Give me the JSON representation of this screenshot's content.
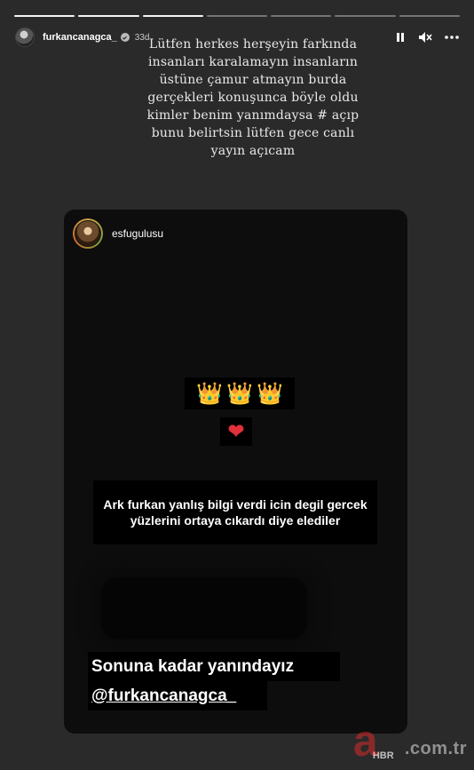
{
  "story": {
    "progress": {
      "total": 7,
      "completed": 3
    },
    "header": {
      "username": "furkancanagca_",
      "time_ago": "33d",
      "icons": [
        "pause-icon",
        "mute-icon",
        "more-icon"
      ]
    },
    "caption": "Lütfen herkes herşeyin farkında insanları karalamayın insanların üstüne çamur atmayın burda gerçekleri konuşunca böyle oldu kimler benim yanımdaysa # açıp bunu belirtsin lütfen gece canlı yayın açıcam",
    "shared_post": {
      "username": "esfugulusu",
      "crowns": [
        "👑",
        "👑",
        "👑"
      ],
      "heart": "❤",
      "message1": "Ark furkan yanlış bilgi verdi icin degil gercek yüzlerini ortaya cıkardı diye elediler",
      "message2": "Sonuna kadar yanındayız",
      "mention": "@furkancanagca_"
    },
    "watermark": {
      "logo": "a",
      "brand": "HBR",
      "domain": ".com.tr"
    },
    "colors": {
      "background": "#2a2a2a",
      "card": "#0d0d0d",
      "heart": "#e0303a",
      "watermark_red": "#d72828"
    }
  }
}
